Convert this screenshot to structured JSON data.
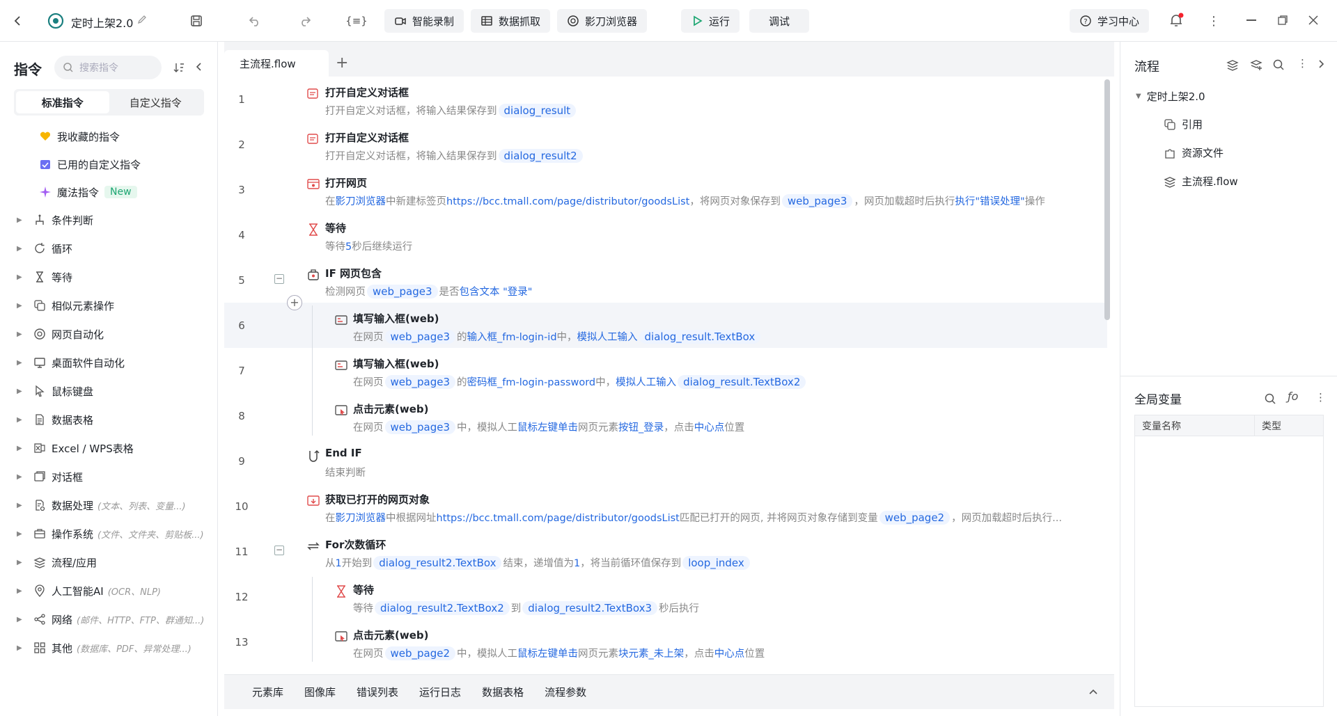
{
  "window": {
    "project_title": "定时上架2.0",
    "toolbar": {
      "smart_record": "智能录制",
      "data_capture": "数据抓取",
      "browser": "影刀浏览器",
      "run": "运行",
      "debug": "调试",
      "learning_center": "学习中心"
    }
  },
  "left_panel": {
    "title": "指令",
    "search_placeholder": "搜索指令",
    "tabs": [
      "标准指令",
      "自定义指令"
    ],
    "special_items": [
      {
        "label": "我收藏的指令",
        "icon": "heart-icon"
      },
      {
        "label": "已用的自定义指令",
        "icon": "calendar-check-icon"
      },
      {
        "label": "魔法指令",
        "icon": "sparkle-icon",
        "badge": "New"
      }
    ],
    "categories": [
      {
        "label": "条件判断",
        "hint": "",
        "icon": "branch-icon"
      },
      {
        "label": "循环",
        "hint": "",
        "icon": "loop-icon"
      },
      {
        "label": "等待",
        "hint": "",
        "icon": "hourglass-icon"
      },
      {
        "label": "相似元素操作",
        "hint": "",
        "icon": "copy-icon"
      },
      {
        "label": "网页自动化",
        "hint": "",
        "icon": "globe-icon"
      },
      {
        "label": "桌面软件自动化",
        "hint": "",
        "icon": "monitor-icon"
      },
      {
        "label": "鼠标键盘",
        "hint": "",
        "icon": "cursor-icon"
      },
      {
        "label": "数据表格",
        "hint": "",
        "icon": "document-icon"
      },
      {
        "label": "Excel / WPS表格",
        "hint": "",
        "icon": "excel-icon"
      },
      {
        "label": "对话框",
        "hint": "",
        "icon": "dialog-icon"
      },
      {
        "label": "数据处理",
        "hint": "(文本、列表、变量...)",
        "icon": "data-process-icon"
      },
      {
        "label": "操作系统",
        "hint": "(文件、文件夹、剪贴板...)",
        "icon": "briefcase-icon"
      },
      {
        "label": "流程/应用",
        "hint": "",
        "icon": "layers-icon"
      },
      {
        "label": "人工智能AI",
        "hint": "(OCR、NLP)",
        "icon": "ai-pin-icon"
      },
      {
        "label": "网络",
        "hint": "(邮件、HTTP、FTP、群通知...)",
        "icon": "share-icon"
      },
      {
        "label": "其他",
        "hint": "(数据库、PDF、异常处理...)",
        "icon": "grid-icon"
      }
    ]
  },
  "editor": {
    "tab_label": "主流程.flow",
    "rows": [
      {
        "num": "1",
        "title": "打开自定义对话框",
        "desc": [
          [
            "t",
            "打开自定义对话框，将输入结果保存到"
          ],
          [
            "v",
            "dialog_result"
          ]
        ]
      },
      {
        "num": "2",
        "title": "打开自定义对话框",
        "desc": [
          [
            "t",
            "打开自定义对话框，将输入结果保存到"
          ],
          [
            "v",
            "dialog_result2"
          ]
        ]
      },
      {
        "num": "3",
        "title": "打开网页",
        "desc": [
          [
            "t",
            "在"
          ],
          [
            "l",
            "影刀浏览器"
          ],
          [
            "t",
            "中新建标签页"
          ],
          [
            "l",
            "https://bcc.tmall.com/page/distributor/goodsList"
          ],
          [
            "t",
            "，将网页对象保存到"
          ],
          [
            "v",
            "web_page3"
          ],
          [
            "t",
            "，网页加载超时后执行"
          ],
          [
            "l",
            "执行\"错误处理\""
          ],
          [
            "t",
            "操作"
          ]
        ]
      },
      {
        "num": "4",
        "title": "等待",
        "desc": [
          [
            "t",
            "等待"
          ],
          [
            "l",
            "5"
          ],
          [
            "t",
            "秒后继续运行"
          ]
        ]
      },
      {
        "num": "5",
        "title": "IF 网页包含",
        "desc": [
          [
            "t",
            "检测网页"
          ],
          [
            "v",
            "web_page3"
          ],
          [
            "t",
            "是否"
          ],
          [
            "l",
            "包含文本 \"登录\""
          ]
        ]
      },
      {
        "num": "6",
        "title": "填写输入框(web)",
        "desc": [
          [
            "t",
            "在网页"
          ],
          [
            "v",
            "web_page3"
          ],
          [
            "t",
            "的"
          ],
          [
            "l",
            "输入框_fm-login-id"
          ],
          [
            "t",
            "中，"
          ],
          [
            "l",
            "模拟人工输入"
          ],
          [
            "v",
            "dialog_result.TextBox"
          ]
        ]
      },
      {
        "num": "7",
        "title": "填写输入框(web)",
        "desc": [
          [
            "t",
            "在网页"
          ],
          [
            "v",
            "web_page3"
          ],
          [
            "t",
            "的"
          ],
          [
            "l",
            "密码框_fm-login-password"
          ],
          [
            "t",
            "中，"
          ],
          [
            "l",
            "模拟人工输入"
          ],
          [
            "v",
            "dialog_result.TextBox2"
          ]
        ]
      },
      {
        "num": "8",
        "title": "点击元素(web)",
        "desc": [
          [
            "t",
            "在网页"
          ],
          [
            "v",
            "web_page3"
          ],
          [
            "t",
            "中，模拟人工"
          ],
          [
            "l",
            "鼠标左键单击"
          ],
          [
            "t",
            "网页元素"
          ],
          [
            "l",
            "按钮_登录"
          ],
          [
            "t",
            "，点击"
          ],
          [
            "l",
            "中心点"
          ],
          [
            "t",
            "位置"
          ]
        ]
      },
      {
        "num": "9",
        "title": "End IF",
        "desc": [
          [
            "t",
            "结束判断"
          ]
        ]
      },
      {
        "num": "10",
        "title": "获取已打开的网页对象",
        "desc": [
          [
            "t",
            "在"
          ],
          [
            "l",
            "影刀浏览器"
          ],
          [
            "t",
            "中根据网址"
          ],
          [
            "l",
            "https://bcc.tmall.com/page/distributor/goodsList"
          ],
          [
            "t",
            "匹配已打开的网页, 并将网页对象存储到变量"
          ],
          [
            "v",
            "web_page2"
          ],
          [
            "t",
            "，网页加载超时后执行..."
          ]
        ]
      },
      {
        "num": "11",
        "title": "For次数循环",
        "desc": [
          [
            "t",
            "从"
          ],
          [
            "l",
            "1"
          ],
          [
            "t",
            "开始到"
          ],
          [
            "v",
            "dialog_result2.TextBox"
          ],
          [
            "t",
            "结束，递增值为"
          ],
          [
            "l",
            "1"
          ],
          [
            "t",
            "，将当前循环值保存到"
          ],
          [
            "v",
            "loop_index"
          ]
        ]
      },
      {
        "num": "12",
        "title": "等待",
        "desc": [
          [
            "t",
            "等待"
          ],
          [
            "v",
            "dialog_result2.TextBox2"
          ],
          [
            "t",
            "到"
          ],
          [
            "v",
            "dialog_result2.TextBox3"
          ],
          [
            "t",
            "秒后执行"
          ]
        ]
      },
      {
        "num": "13",
        "title": "点击元素(web)",
        "desc": [
          [
            "t",
            "在网页"
          ],
          [
            "v",
            "web_page2"
          ],
          [
            "t",
            "中，模拟人工"
          ],
          [
            "l",
            "鼠标左键单击"
          ],
          [
            "t",
            "网页元素"
          ],
          [
            "l",
            "块元素_未上架"
          ],
          [
            "t",
            "，点击"
          ],
          [
            "l",
            "中心点"
          ],
          [
            "t",
            "位置"
          ]
        ]
      }
    ]
  },
  "bottom_tabs": [
    "元素库",
    "图像库",
    "错误列表",
    "运行日志",
    "数据表格",
    "流程参数"
  ],
  "right_panel": {
    "flow_title": "流程",
    "tree_root": "定时上架2.0",
    "tree_children": [
      "引用",
      "资源文件",
      "主流程.flow"
    ],
    "vars_title": "全局变量",
    "vars_columns": [
      "变量名称",
      "类型"
    ]
  },
  "colors": {
    "accent": "#2468e0",
    "run_green": "#1ea672",
    "notify_red": "#f5222d"
  }
}
